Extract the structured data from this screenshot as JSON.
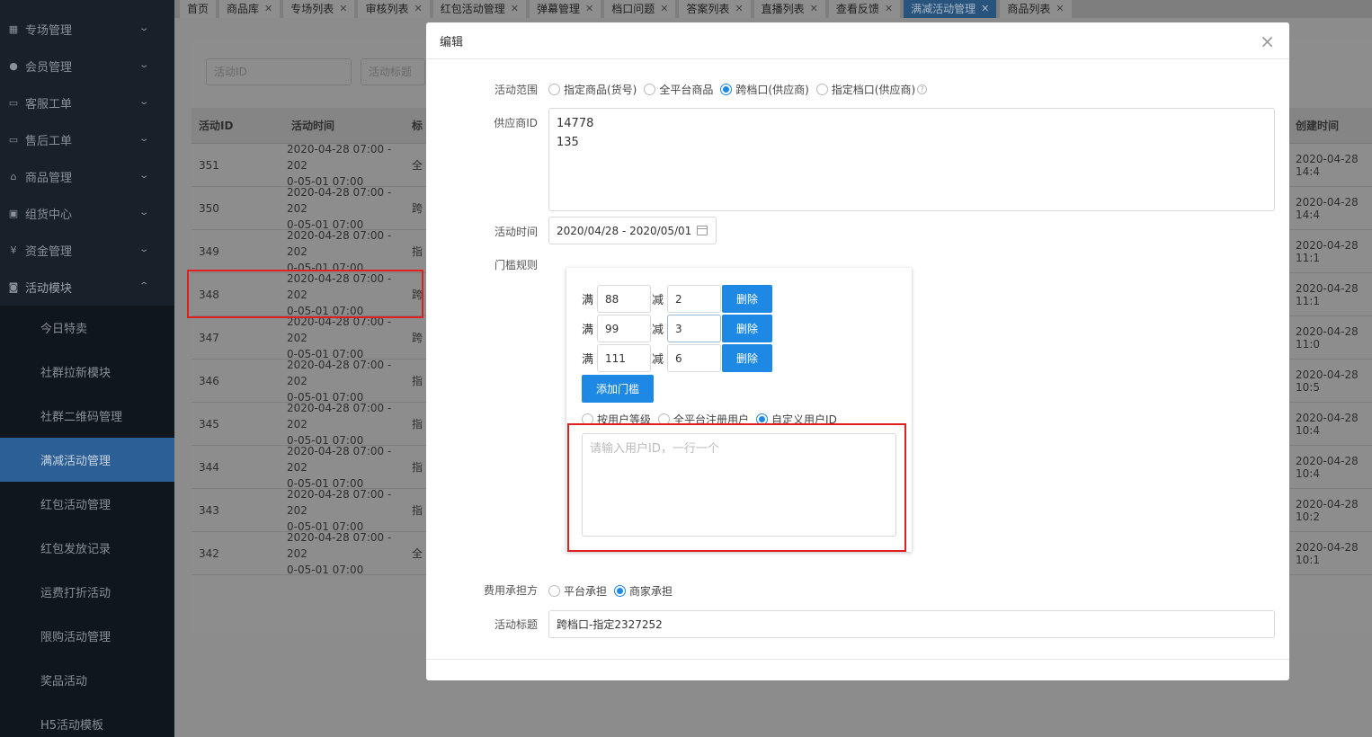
{
  "sidebar": {
    "groups": [
      {
        "label": "专场管理",
        "icon": "list-icon"
      },
      {
        "label": "会员管理",
        "icon": "users-icon"
      },
      {
        "label": "客服工单",
        "icon": "ticket-icon"
      },
      {
        "label": "售后工单",
        "icon": "ticket-icon"
      },
      {
        "label": "商品管理",
        "icon": "home-icon"
      },
      {
        "label": "组货中心",
        "icon": "lock-icon"
      },
      {
        "label": "资金管理",
        "icon": "yen-icon"
      },
      {
        "label": "活动模块",
        "icon": "gamepad-icon"
      }
    ],
    "sub_items": [
      "今日特卖",
      "社群拉新模块",
      "社群二维码管理",
      "满减活动管理",
      "红包活动管理",
      "红包发放记录",
      "运费打折活动",
      "限购活动管理",
      "奖品活动",
      "H5活动模板"
    ]
  },
  "tabs": [
    "首页",
    "商品库",
    "专场列表",
    "审核列表",
    "红包活动管理",
    "弹幕管理",
    "档口问题",
    "答案列表",
    "直播列表",
    "查看反馈",
    "满减活动管理",
    "商品列表"
  ],
  "filters": {
    "activity_id_placeholder": "活动ID",
    "activity_title_placeholder": "活动标题"
  },
  "table": {
    "headers": {
      "id": "活动ID",
      "time": "活动时间",
      "title": "标",
      "created": "创建时间"
    },
    "rows": [
      {
        "id": "351",
        "time1": "2020-04-28 07:00 - 202",
        "time2": "0-05-01 07:00",
        "title": "全",
        "created": "2020-04-28 14:4"
      },
      {
        "id": "350",
        "time1": "2020-04-28 07:00 - 202",
        "time2": "0-05-01 07:00",
        "title": "跨",
        "created": "2020-04-28 14:4"
      },
      {
        "id": "349",
        "time1": "2020-04-28 07:00 - 202",
        "time2": "0-05-01 07:00",
        "title": "指",
        "created": "2020-04-28 11:1"
      },
      {
        "id": "348",
        "time1": "2020-04-28 07:00 - 202",
        "time2": "0-05-01 07:00",
        "title": "跨",
        "created": "2020-04-28 11:1"
      },
      {
        "id": "347",
        "time1": "2020-04-28 07:00 - 202",
        "time2": "0-05-01 07:00",
        "title": "跨",
        "created": "2020-04-28 11:0"
      },
      {
        "id": "346",
        "time1": "2020-04-28 07:00 - 202",
        "time2": "0-05-01 07:00",
        "title": "指",
        "created": "2020-04-28 10:5"
      },
      {
        "id": "345",
        "time1": "2020-04-28 07:00 - 202",
        "time2": "0-05-01 07:00",
        "title": "指",
        "created": "2020-04-28 10:4"
      },
      {
        "id": "344",
        "time1": "2020-04-28 07:00 - 202",
        "time2": "0-05-01 07:00",
        "title": "指",
        "created": "2020-04-28 10:4"
      },
      {
        "id": "343",
        "time1": "2020-04-28 07:00 - 202",
        "time2": "0-05-01 07:00",
        "title": "指",
        "created": "2020-04-28 10:2"
      },
      {
        "id": "342",
        "time1": "2020-04-28 07:00 - 202",
        "time2": "0-05-01 07:00",
        "title": "全",
        "created": "2020-04-28 10:1"
      }
    ]
  },
  "modal": {
    "title": "编辑",
    "close": "×",
    "scope": {
      "label": "活动范围",
      "options": [
        "指定商品(货号)",
        "全平台商品",
        "跨档口(供应商)",
        "指定档口(供应商)"
      ],
      "selected": 2,
      "help": "?"
    },
    "supplier": {
      "label": "供应商ID",
      "value": "14778\n135"
    },
    "time": {
      "label": "活动时间",
      "value": "2020/04/28 - 2020/05/01"
    },
    "rules": {
      "label": "门槛规则",
      "full_label": "满",
      "minus_label": "减",
      "items": [
        {
          "full": "88",
          "minus": "2"
        },
        {
          "full": "99",
          "minus": "3"
        },
        {
          "full": "111",
          "minus": "6"
        }
      ],
      "delete_label": "删除",
      "add_label": "添加门槛",
      "user_options": [
        "按用户等级",
        "全平台注册用户",
        "自定义用户ID"
      ],
      "user_selected": 2,
      "user_ids_placeholder": "请输入用户ID，一行一个"
    },
    "cost": {
      "label": "费用承担方",
      "options": [
        "平台承担",
        "商家承担"
      ],
      "selected": 1
    },
    "activity_title": {
      "label": "活动标题",
      "value": "跨档口-指定2327252"
    }
  },
  "colors": {
    "primary": "#1e88e5",
    "sidebar_bg": "#182029",
    "active_tab": "#27537c",
    "annotation_red": "#e02020"
  }
}
